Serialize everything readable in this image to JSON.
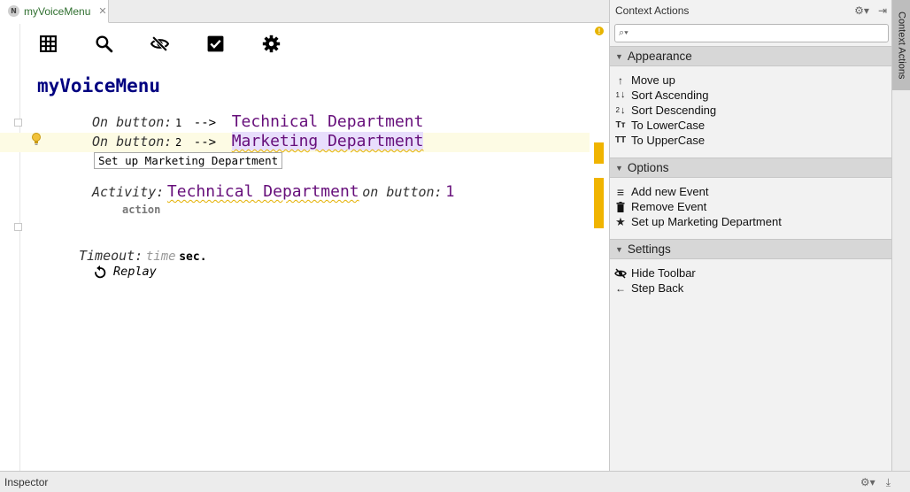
{
  "tab": {
    "badge": "N",
    "label": "myVoiceMenu",
    "close": "✕"
  },
  "editor": {
    "title": "myVoiceMenu",
    "warning_glyph": "!",
    "keyword_on_button": "On button:",
    "arrow": "-->",
    "rows": [
      {
        "button_number": "1",
        "department": "Technical Department"
      },
      {
        "button_number": "2",
        "department": "Marketing Department"
      }
    ],
    "hint": "Set up Marketing Department",
    "activity": {
      "keyword": "Activity:",
      "department": "Technical Department",
      "on_button_kw": "on button:",
      "button_number": "1",
      "action_label": "action"
    },
    "timeout": {
      "keyword": "Timeout:",
      "placeholder": "time",
      "unit": "sec."
    },
    "replay_label": "Replay",
    "toolbar_icons": [
      "table-icon",
      "search-icon",
      "eye-slash-icon",
      "checkbox-icon",
      "gear-icon"
    ]
  },
  "panel": {
    "title": "Context Actions",
    "search_placeholder": "",
    "sections": [
      {
        "title": "Appearance",
        "items": [
          {
            "label": "Move up",
            "icon": "arrow-up-icon",
            "glyph": "↑"
          },
          {
            "label": "Sort Ascending",
            "icon": "sort-ascending-icon",
            "glyph": "↓"
          },
          {
            "label": "Sort Descending",
            "icon": "sort-descending-icon",
            "glyph": "↓"
          },
          {
            "label": "To LowerCase",
            "icon": "lowercase-icon",
            "glyph": "Tт"
          },
          {
            "label": "To UpperCase",
            "icon": "uppercase-icon",
            "glyph": "TT"
          }
        ]
      },
      {
        "title": "Options",
        "items": [
          {
            "label": "Add new Event",
            "icon": "add-list-icon",
            "glyph": "≡"
          },
          {
            "label": "Remove Event",
            "icon": "trash-icon",
            "glyph": "🗑"
          },
          {
            "label": "Set up Marketing Department",
            "icon": "star-icon",
            "glyph": "★"
          }
        ]
      },
      {
        "title": "Settings",
        "items": [
          {
            "label": "Hide Toolbar",
            "icon": "eye-slash-icon",
            "glyph": "⊘"
          },
          {
            "label": "Step Back",
            "icon": "arrow-left-icon",
            "glyph": "←"
          }
        ]
      }
    ]
  },
  "side_tab": {
    "label": "Context Actions"
  },
  "bottom": {
    "label": "Inspector"
  },
  "colors": {
    "title_blue": "#000080",
    "department_purple": "#660e7a",
    "warning_yellow": "#f0b400",
    "selection": "#e8defc"
  }
}
